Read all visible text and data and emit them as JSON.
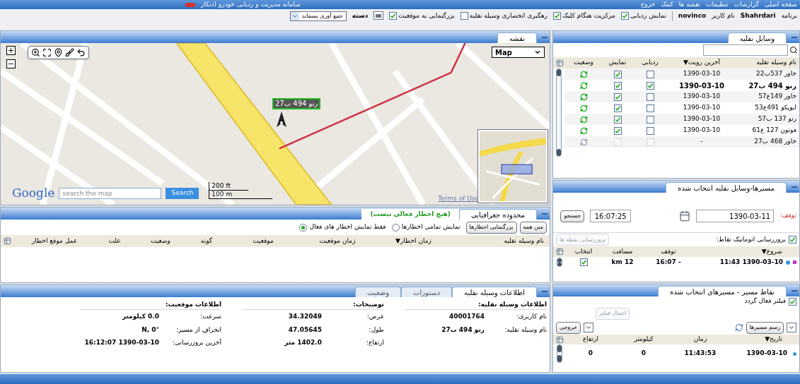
{
  "header": {
    "title": "سامانه مدیریت و ردیابی خودرو (دنکار",
    "menu": [
      "صفحه اصلی",
      "گزارشات",
      "تنظیمات",
      "نقشه ها",
      "کمک",
      "خروج"
    ]
  },
  "toolbar": {
    "program_label": "برنامه",
    "program": "Shahrdari",
    "user_label": "نام کاربر",
    "user": "novinco",
    "options": [
      {
        "label": "نمایش ردیابی",
        "checked": true
      },
      {
        "label": "مرکزیت هنگام کلیک",
        "checked": true
      },
      {
        "label": "رهگیری انحصاری وسیله نقلیه",
        "checked": false
      },
      {
        "label": "بزرگنمایی به موقعیت",
        "checked": true
      }
    ],
    "group_label": "دسته",
    "group_value": "جمع آوری پسماند"
  },
  "vehicles": {
    "tab": "وسایل نقلیه",
    "columns": [
      "نام وسیله نقلیه",
      "آخرین رویت▼",
      "ردیابی",
      "نمایش",
      "وضعیت"
    ],
    "rows": [
      {
        "name": "خاور 537ب22",
        "last_seen": "1390-03-10",
        "tracking": false,
        "shown": true,
        "online": true,
        "selected": false,
        "disabled": false
      },
      {
        "name": "رنو 494 ب27",
        "last_seen": "1390-03-10",
        "tracking": true,
        "shown": true,
        "online": true,
        "selected": true,
        "disabled": false
      },
      {
        "name": "خاور 149ع57",
        "last_seen": "1390-03-10",
        "tracking": false,
        "shown": true,
        "online": true,
        "selected": false,
        "disabled": false
      },
      {
        "name": "ایویکو 491ع53",
        "last_seen": "1390-03-10",
        "tracking": false,
        "shown": true,
        "online": true,
        "selected": false,
        "disabled": false
      },
      {
        "name": "رنو 137 ب57",
        "last_seen": "1390-03-10",
        "tracking": false,
        "shown": true,
        "online": true,
        "selected": false,
        "disabled": false
      },
      {
        "name": "فوتون 127 ع61",
        "last_seen": "1390-03-10",
        "tracking": false,
        "shown": true,
        "online": true,
        "selected": false,
        "disabled": false
      },
      {
        "name": "خاور 468 ب27",
        "last_seen": "-",
        "tracking": false,
        "shown": false,
        "online": false,
        "selected": false,
        "disabled": true
      }
    ]
  },
  "map": {
    "tab": "نقشه",
    "map_type": "Map",
    "marker_label": "رنو 494 ب27",
    "logo": "Google",
    "search": {
      "placeholder": "search the map",
      "button": "Search"
    },
    "scale": [
      "200 ft",
      "100 m"
    ],
    "terms": "Terms of Use"
  },
  "alerts": {
    "tabs": [
      {
        "label": "محدوده جغرافیایی",
        "selected": true
      }
    ],
    "status": "(هیچ اخطار فعالی نیست)",
    "buttons": [
      "متن همه",
      "بزرگنمایی اخطارها"
    ],
    "filters": [
      {
        "label": "نمایش تمامی اخطارها",
        "selected": false
      },
      {
        "label": "فقط نمایش اخطار های فعال",
        "selected": true
      }
    ],
    "columns": [
      "نام وسیله نقلیه",
      "زمان اخطار▼",
      "زمان موقعیت",
      "موقعیت",
      "گونه",
      "وضعیت",
      "علت",
      "عمل موقع اخطار"
    ]
  },
  "routes": {
    "tab": "مسیرها-وسایل نقلیه انتخاب شده",
    "stop_label": "توقف:",
    "stop_date": "1390-03-11",
    "stop_time": "16:07:25",
    "search_button": "جستجو",
    "auto_update": {
      "label": "بروزرسانی اتوماتیک نقاط:",
      "checked": true
    },
    "update_button": {
      "label": "بروزرسانی نقطه ها",
      "disabled": true
    },
    "columns": [
      "شروع▼",
      "توقف",
      "مسافت",
      "انتخاب"
    ],
    "rows": [
      {
        "start": "11:43 1390-03-10",
        "stop": "16:07 -",
        "distance": "km 12",
        "selected": true,
        "color": "#cc33cc"
      }
    ]
  },
  "info": {
    "tabs": [
      {
        "label": "اطلاعات وسیله نقلیه",
        "selected": true
      },
      {
        "label": "دستورات",
        "selected": false
      },
      {
        "label": "وضعیت",
        "selected": false
      }
    ],
    "sections": [
      {
        "title": "اطلاعات وسیله نقلیه:",
        "fields": [
          {
            "label": "نام کاربری:",
            "value": "40001764"
          },
          {
            "label": "نام وسیله نقلیه:",
            "value": "رنو 494 ب27"
          }
        ]
      },
      {
        "title": "توضیحات:",
        "fields": [
          {
            "label": "عرض:",
            "value": "34.32049"
          },
          {
            "label": "طول:",
            "value": "47.05645"
          },
          {
            "label": "ارتفاع:",
            "value": "1402.0 متر"
          }
        ]
      },
      {
        "title": "اطلاعات موقعیت:",
        "fields": [
          {
            "label": "سرعت:",
            "value": "0.0 کیلومتر"
          },
          {
            "label": "انحراف از مسیر:",
            "value": "N, 0°"
          },
          {
            "label": "آخرین بروزرسانی:",
            "value": "16:12:07 1390-03-10"
          }
        ]
      }
    ]
  },
  "points": {
    "tab": "نقاط مسیر - مسیرهای انتخاب شده",
    "filter": {
      "label": "فیلتر فعال گردد",
      "checked": true
    },
    "apply_button": {
      "label": "اعمال فیلتر",
      "disabled": true
    },
    "draw_button": "رسم مسیرها",
    "export_button": "خروجی",
    "columns": [
      "تاریخ▼",
      "زمان",
      "کیلومتر",
      "ارتفاع"
    ],
    "rows": [
      {
        "cells": [
          "1390-03-10",
          "11:43:53",
          "0",
          "0"
        ],
        "color": "#3399dd"
      }
    ]
  }
}
